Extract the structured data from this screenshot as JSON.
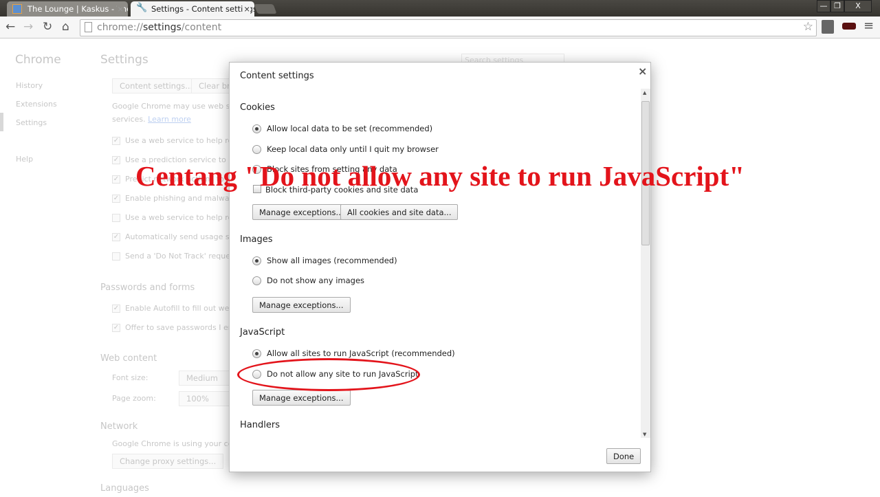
{
  "browser": {
    "tabs": [
      {
        "label": "The Lounge | Kaskus - The",
        "active": false
      },
      {
        "label": "Settings - Content settings",
        "active": true
      }
    ],
    "url_scheme": "chrome://",
    "url_host": "settings",
    "url_path": "/content",
    "window_controls": {
      "minimize": "—",
      "restore": "❐",
      "close": "X"
    }
  },
  "page": {
    "sidebar": {
      "title": "Chrome",
      "items": [
        "History",
        "Extensions",
        "Settings",
        "Help"
      ],
      "active": "Settings"
    },
    "title": "Settings",
    "search_placeholder": "Search settings",
    "privacy_buttons": [
      "Content settings...",
      "Clear bro"
    ],
    "privacy_text_1": "Google Chrome may use web serv",
    "privacy_text_2": "services.",
    "learn_more": "Learn more",
    "privacy_checks": [
      {
        "label": "Use a web service to help resol",
        "checked": true
      },
      {
        "label": "Use a prediction service to help",
        "checked": true
      },
      {
        "label": "Predict network actions to im",
        "checked": true
      },
      {
        "label": "Enable phishing and malware p",
        "checked": true
      },
      {
        "label": "Use a web service to help resol",
        "checked": false
      },
      {
        "label": "Automatically send usage stati",
        "checked": true
      },
      {
        "label": "Send a 'Do Not Track' request",
        "checked": false
      }
    ],
    "passwords_heading": "Passwords and forms",
    "password_checks": [
      {
        "label": "Enable Autofill to fill out web f",
        "checked": true
      },
      {
        "label": "Offer to save passwords I enter",
        "checked": true
      }
    ],
    "web_content_heading": "Web content",
    "font_size_label": "Font size:",
    "font_size_value": "Medium",
    "page_zoom_label": "Page zoom:",
    "page_zoom_value": "100%",
    "network_heading": "Network",
    "network_text": "Google Chrome is using your com",
    "proxy_button": "Change proxy settings...",
    "languages_heading": "Languages"
  },
  "dialog": {
    "title": "Content settings",
    "close": "×",
    "cookies": {
      "heading": "Cookies",
      "options": [
        "Allow local data to be set (recommended)",
        "Keep local data only until I quit my browser",
        "Block sites from setting any data"
      ],
      "selected": 0,
      "checkbox": "Block third-party cookies and site data",
      "checkbox_checked": false,
      "buttons": [
        "Manage exceptions...",
        "All cookies and site data..."
      ]
    },
    "images": {
      "heading": "Images",
      "options": [
        "Show all images (recommended)",
        "Do not show any images"
      ],
      "selected": 0,
      "button": "Manage exceptions..."
    },
    "javascript": {
      "heading": "JavaScript",
      "options": [
        "Allow all sites to run JavaScript (recommended)",
        "Do not allow any site to run JavaScript"
      ],
      "selected": 0,
      "button": "Manage exceptions..."
    },
    "handlers": {
      "heading": "Handlers"
    },
    "done": "Done"
  },
  "annotation": {
    "text": "Centang \"Do not allow any site to run JavaScript\"",
    "color": "#e3141b"
  }
}
